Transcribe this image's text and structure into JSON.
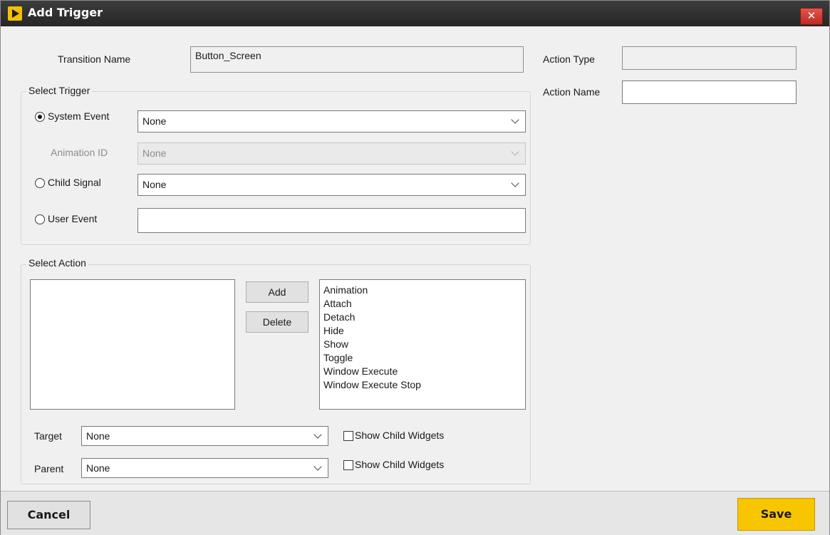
{
  "window": {
    "title": "Add Trigger",
    "close_glyph": "✕",
    "app_icon": "play-logo-icon",
    "accent": "#f8c600"
  },
  "transition": {
    "label": "Transition Name",
    "value": "Button_Screen"
  },
  "action_type": {
    "label": "Action Type",
    "value": ""
  },
  "action_name": {
    "label": "Action Name",
    "value": ""
  },
  "select_trigger": {
    "title": "Select Trigger",
    "system_event": {
      "label": "System Event",
      "value": "None",
      "selected": true
    },
    "animation_id": {
      "label": "Animation ID",
      "value": "None",
      "enabled": false
    },
    "child_signal": {
      "label": "Child Signal",
      "value": "None",
      "selected": false
    },
    "user_event": {
      "label": "User Event",
      "value": "",
      "selected": false
    }
  },
  "select_action": {
    "title": "Select Action",
    "add_label": "Add",
    "delete_label": "Delete",
    "available_actions": [
      "Animation",
      "Attach",
      "Detach",
      "Hide",
      "Show",
      "Toggle",
      "Window Execute",
      "Window Execute Stop"
    ],
    "target": {
      "label": "Target",
      "value": "None",
      "checkbox_label": "Show Child Widgets",
      "checked": false
    },
    "parent": {
      "label": "Parent",
      "value": "None",
      "checkbox_label": "Show Child Widgets",
      "checked": false
    }
  },
  "footer": {
    "cancel_label": "Cancel",
    "save_label": "Save"
  }
}
